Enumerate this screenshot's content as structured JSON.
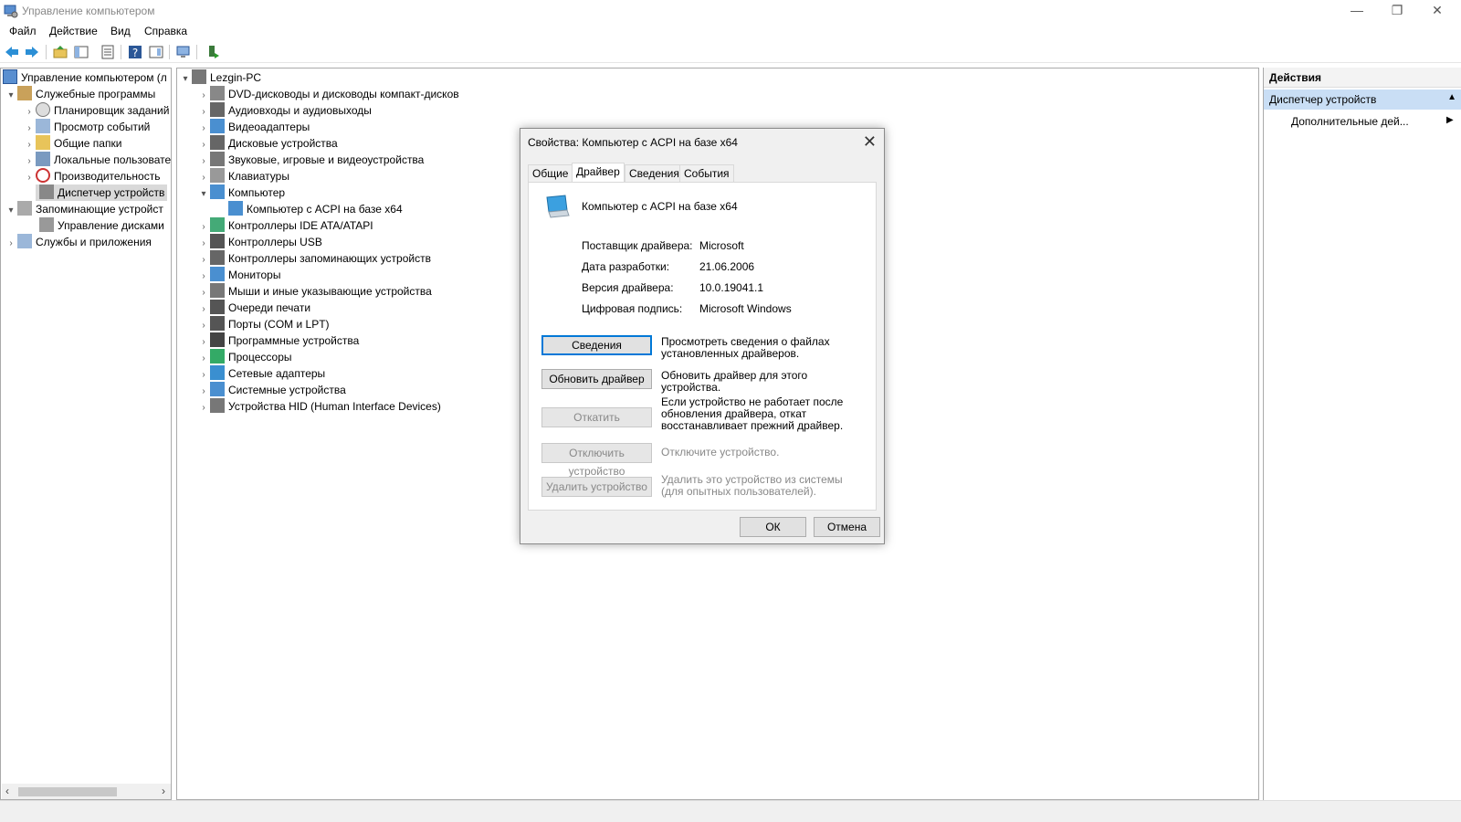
{
  "window": {
    "title": "Управление компьютером",
    "controls": {
      "minimize": "—",
      "restore": "❐",
      "close": "✕"
    }
  },
  "menu": [
    "Файл",
    "Действие",
    "Вид",
    "Справка"
  ],
  "left_tree": {
    "root": "Управление компьютером (л",
    "items": [
      {
        "label": "Служебные программы",
        "level": 1,
        "expanded": true
      },
      {
        "label": "Планировщик заданий",
        "level": 2
      },
      {
        "label": "Просмотр событий",
        "level": 2
      },
      {
        "label": "Общие папки",
        "level": 2
      },
      {
        "label": "Локальные пользовате",
        "level": 2
      },
      {
        "label": "Производительность",
        "level": 2
      },
      {
        "label": "Диспетчер устройств",
        "level": 2,
        "selected": true
      },
      {
        "label": "Запоминающие устройст",
        "level": 1,
        "expanded": true
      },
      {
        "label": "Управление дисками",
        "level": 2
      },
      {
        "label": "Службы и приложения",
        "level": 1
      }
    ]
  },
  "device_tree": {
    "root": "Lezgin-PC",
    "items": [
      "DVD-дисководы и дисководы компакт-дисков",
      "Аудиовходы и аудиовыходы",
      "Видеоадаптеры",
      "Дисковые устройства",
      "Звуковые, игровые и видеоустройства",
      "Клавиатуры",
      "Компьютер",
      "Компьютер с ACPI на базе x64",
      "Контроллеры IDE ATA/ATAPI",
      "Контроллеры USB",
      "Контроллеры запоминающих устройств",
      "Мониторы",
      "Мыши и иные указывающие устройства",
      "Очереди печати",
      "Порты (COM и LPT)",
      "Программные устройства",
      "Процессоры",
      "Сетевые адаптеры",
      "Системные устройства",
      "Устройства HID (Human Interface Devices)"
    ]
  },
  "actions": {
    "header": "Действия",
    "selected": "Диспетчер устройств",
    "item": "Дополнительные дей..."
  },
  "dialog": {
    "title": "Свойства: Компьютер с ACPI на базе x64",
    "tabs": [
      "Общие",
      "Драйвер",
      "Сведения",
      "События"
    ],
    "active_tab": "Драйвер",
    "device_name": "Компьютер с ACPI на базе x64",
    "props": [
      {
        "label": "Поставщик драйвера:",
        "value": "Microsoft"
      },
      {
        "label": "Дата разработки:",
        "value": "21.06.2006"
      },
      {
        "label": "Версия драйвера:",
        "value": "10.0.19041.1"
      },
      {
        "label": "Цифровая подпись:",
        "value": "Microsoft Windows"
      }
    ],
    "buttons": [
      {
        "label": "Сведения",
        "desc": "Просмотреть сведения о файлах установленных драйверов."
      },
      {
        "label": "Обновить драйвер",
        "desc": "Обновить драйвер для этого устройства."
      },
      {
        "label": "Откатить",
        "desc": "Если устройство не работает после обновления драйвера, откат восстанавливает прежний драйвер."
      },
      {
        "label": "Отключить устройство",
        "desc": "Отключите устройство."
      },
      {
        "label": "Удалить устройство",
        "desc": "Удалить это устройство из системы (для опытных пользователей)."
      }
    ],
    "ok": "ОК",
    "cancel": "Отмена"
  }
}
